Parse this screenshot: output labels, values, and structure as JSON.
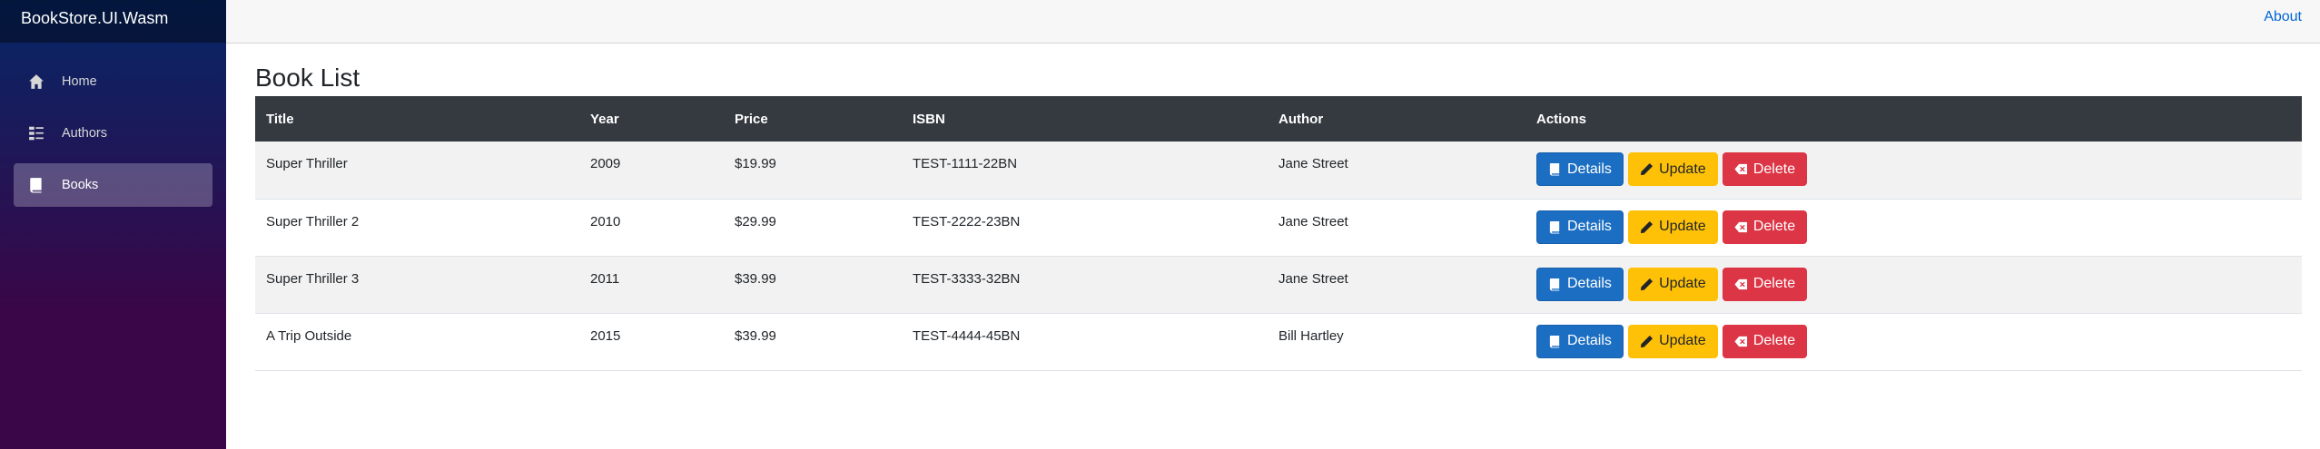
{
  "app": {
    "brand": "BookStore.UI.Wasm"
  },
  "sidebar": {
    "items": [
      {
        "label": "Home",
        "icon": "home-icon"
      },
      {
        "label": "Authors",
        "icon": "list-icon"
      },
      {
        "label": "Books",
        "icon": "book-icon",
        "active": true
      }
    ]
  },
  "topbar": {
    "about_label": "About"
  },
  "page": {
    "title": "Book List"
  },
  "table": {
    "headers": [
      "Title",
      "Year",
      "Price",
      "ISBN",
      "Author",
      "Actions"
    ],
    "rows": [
      {
        "title": "Super Thriller",
        "year": "2009",
        "price": "$19.99",
        "isbn": "TEST-1111-22BN",
        "author": "Jane Street"
      },
      {
        "title": "Super Thriller 2",
        "year": "2010",
        "price": "$29.99",
        "isbn": "TEST-2222-23BN",
        "author": "Jane Street"
      },
      {
        "title": "Super Thriller 3",
        "year": "2011",
        "price": "$39.99",
        "isbn": "TEST-3333-32BN",
        "author": "Jane Street"
      },
      {
        "title": "A Trip Outside",
        "year": "2015",
        "price": "$39.99",
        "isbn": "TEST-4444-45BN",
        "author": "Bill Hartley"
      }
    ],
    "actions": {
      "details": "Details",
      "update": "Update",
      "delete": "Delete"
    }
  },
  "colors": {
    "primary": "#1b6ec2",
    "warning": "#ffc107",
    "danger": "#dc3545",
    "header_bg": "#343a40",
    "link": "#0366d6"
  }
}
